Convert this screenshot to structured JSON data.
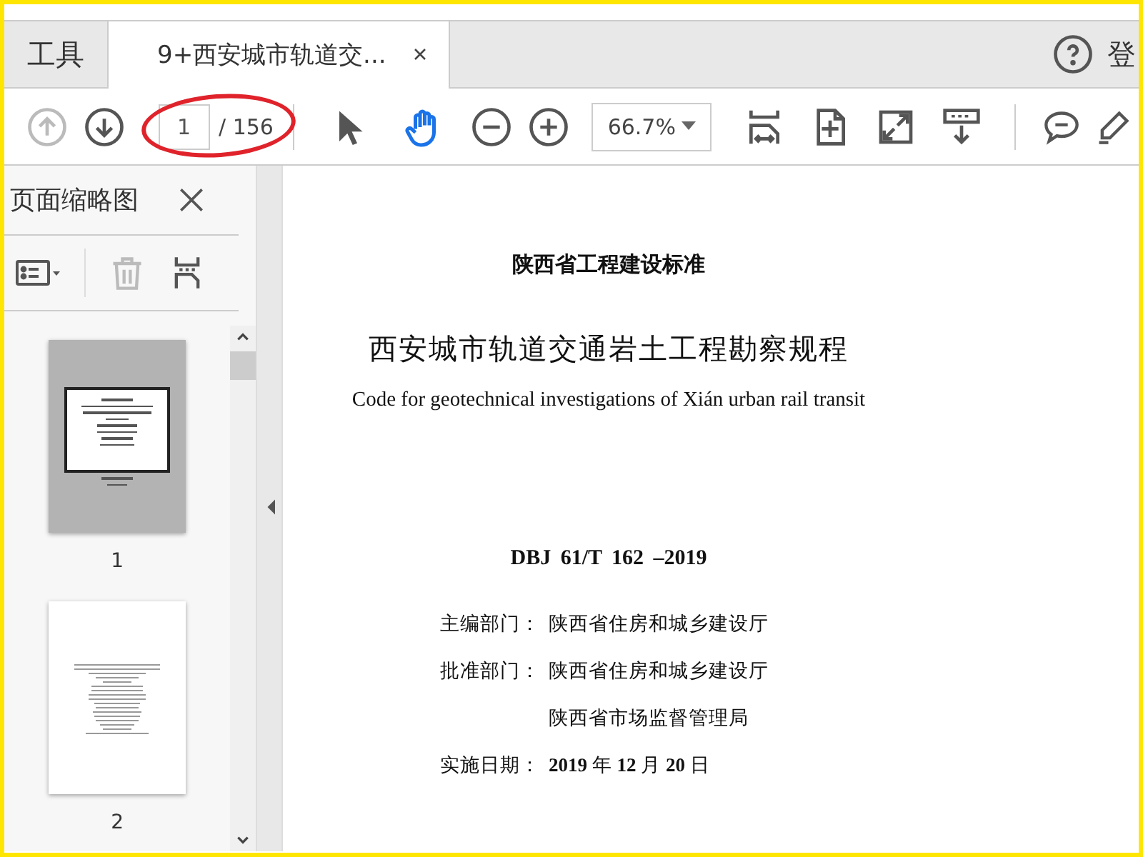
{
  "tabs": [
    {
      "label": "工具",
      "selected": false,
      "closable": false
    },
    {
      "label": "9+西安城市轨道交...",
      "selected": true,
      "closable": true
    }
  ],
  "header_right": {
    "partial_label": "登"
  },
  "toolbar": {
    "prev_page_disabled": true,
    "page_number": "1",
    "page_total": "/ 156",
    "page_number_circled": true,
    "tools": [
      {
        "kind": "select",
        "selected": false
      },
      {
        "kind": "hand",
        "selected": true
      }
    ],
    "zoom": "66.7%"
  },
  "thumbnails_panel": {
    "title": "页面缩略图",
    "pages": [
      {
        "label": "1",
        "selected": true
      },
      {
        "label": "2",
        "selected": false
      }
    ]
  },
  "document": {
    "lines": [
      {
        "kind": "org",
        "text": "陕西省工程建设标准"
      },
      {
        "kind": "title",
        "text": "西安城市轨道交通岩土工程勘察规程"
      },
      {
        "kind": "subtitle",
        "text": "Code for geotechnical investigations of Xián urban rail transit"
      },
      {
        "kind": "code",
        "text": "DBJ 61/T 162 –2019"
      },
      {
        "kind": "field",
        "label": "主编部门：",
        "value": "陕西省住房和城乡建设厅"
      },
      {
        "kind": "field",
        "label": "批准部门：",
        "value": "陕西省住房和城乡建设厅"
      },
      {
        "kind": "continuation",
        "value": "陕西省市场监督管理局"
      },
      {
        "kind": "field",
        "label": "实施日期：",
        "value": "**2019** 年 **12** 月 **20** 日"
      }
    ]
  }
}
